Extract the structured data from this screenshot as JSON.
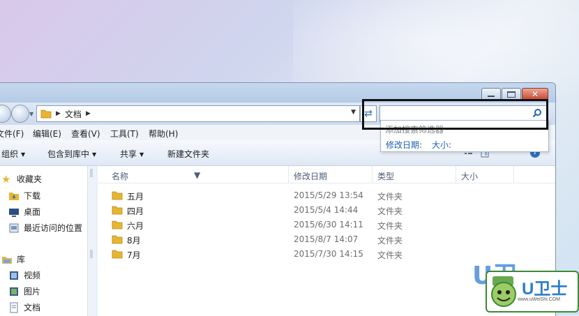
{
  "window": {
    "path": [
      "文档"
    ],
    "search_placeholder": "",
    "menu": [
      "文件(F)",
      "编辑(E)",
      "查看(V)",
      "工具(T)",
      "帮助(H)"
    ],
    "toolbar": [
      "组织",
      "包含到库中",
      "共享",
      "新建文件夹"
    ],
    "columns": [
      "名称",
      "修改日期",
      "类型",
      "大小"
    ]
  },
  "search_dropdown": {
    "hint": "添加搜索筛选器",
    "filters": [
      "修改日期:",
      "大小:"
    ]
  },
  "nav_pane": {
    "favorites_label": "收藏夹",
    "favorites": [
      "下载",
      "桌面",
      "最近访问的位置"
    ],
    "library_label": "库",
    "libraries": [
      "视频",
      "图片",
      "文档"
    ]
  },
  "files": [
    {
      "name": "五月",
      "date": "2015/5/29 13:54",
      "type": "文件夹"
    },
    {
      "name": "四月",
      "date": "2015/5/4 14:44",
      "type": "文件夹"
    },
    {
      "name": "六月",
      "date": "2015/6/30 14:11",
      "type": "文件夹"
    },
    {
      "name": "8月",
      "date": "2015/8/7 14:07",
      "type": "文件夹"
    },
    {
      "name": "7月",
      "date": "2015/7/30 14:15",
      "type": "文件夹"
    }
  ],
  "watermark": {
    "brand": "U卫士",
    "url": "www.uWeiShi.COM",
    "partial": "U卫"
  },
  "colors": {
    "accent": "#1a5fb4",
    "folder": "#e8b533",
    "close": "#c8452d"
  }
}
